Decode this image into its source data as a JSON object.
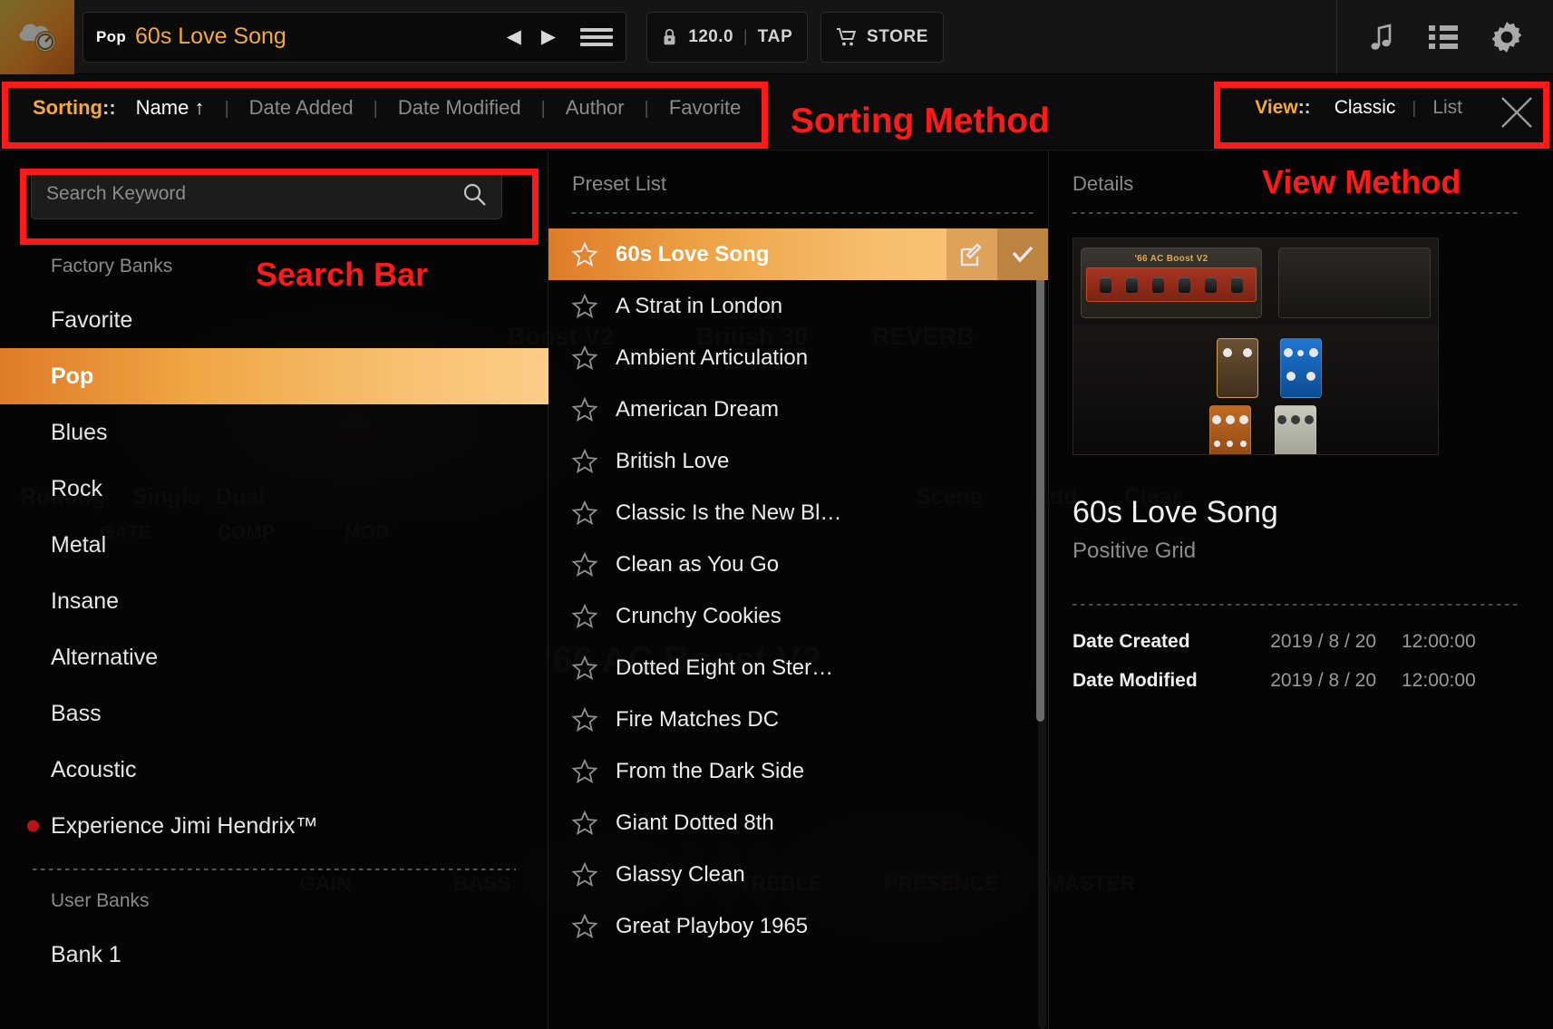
{
  "topbar": {
    "logo_icon": "cloud-gauge-logo",
    "preset_bank": "Pop",
    "preset_name": "60s Love Song",
    "prev_icon": "prev-arrow-icon",
    "next_icon": "next-arrow-icon",
    "menu_icon": "hamburger-menu-icon",
    "lock_icon": "lock-icon",
    "tempo_value": "120.0",
    "tempo_divider": "|",
    "tap_label": "TAP",
    "cart_icon": "shopping-cart-icon",
    "store_label": "STORE",
    "tone_icon": "music-note-icon",
    "list_icon": "list-view-icon",
    "settings_icon": "gear-icon"
  },
  "sortbar": {
    "label": "Sorting",
    "colons": "::",
    "items": [
      {
        "label": "Name ↑",
        "active": true
      },
      {
        "label": "Date Added",
        "active": false
      },
      {
        "label": "Date Modified",
        "active": false
      },
      {
        "label": "Author",
        "active": false
      },
      {
        "label": "Favorite",
        "active": false
      }
    ],
    "separator": "|"
  },
  "viewbar": {
    "label": "View",
    "colons": "::",
    "items": [
      {
        "label": "Classic",
        "active": true
      },
      {
        "label": "List",
        "active": false
      }
    ],
    "separator": "|",
    "close_icon": "close-x-icon"
  },
  "annotations": [
    {
      "text": "Sorting Method"
    },
    {
      "text": "View Method"
    },
    {
      "text": "Search Bar"
    }
  ],
  "search": {
    "placeholder": "Search Keyword",
    "value": "",
    "icon": "search-icon"
  },
  "banks": {
    "factory_header": "Factory Banks",
    "user_header": "User Banks",
    "factory_items": [
      {
        "label": "Favorite",
        "selected": false,
        "dot": false
      },
      {
        "label": "Pop",
        "selected": true,
        "dot": false
      },
      {
        "label": "Blues",
        "selected": false,
        "dot": false
      },
      {
        "label": "Rock",
        "selected": false,
        "dot": false
      },
      {
        "label": "Metal",
        "selected": false,
        "dot": false
      },
      {
        "label": "Insane",
        "selected": false,
        "dot": false
      },
      {
        "label": "Alternative",
        "selected": false,
        "dot": false
      },
      {
        "label": "Bass",
        "selected": false,
        "dot": false
      },
      {
        "label": "Acoustic",
        "selected": false,
        "dot": false
      },
      {
        "label": "Experience Jimi Hendrix™",
        "selected": false,
        "dot": true
      }
    ],
    "user_items": [
      {
        "label": "Bank 1",
        "selected": false,
        "dot": false
      }
    ]
  },
  "presets": {
    "title": "Preset List",
    "star_icon": "star-outline-icon",
    "edit_icon": "edit-pencil-icon",
    "check_icon": "check-mark-icon",
    "items": [
      {
        "label": "60s Love Song",
        "selected": true
      },
      {
        "label": "A Strat in London",
        "selected": false
      },
      {
        "label": "Ambient Articulation",
        "selected": false
      },
      {
        "label": "American Dream",
        "selected": false
      },
      {
        "label": "British Love",
        "selected": false
      },
      {
        "label": "Classic Is the New Bl…",
        "selected": false
      },
      {
        "label": "Clean as You Go",
        "selected": false
      },
      {
        "label": "Crunchy Cookies",
        "selected": false
      },
      {
        "label": "Dotted Eight on Ster…",
        "selected": false
      },
      {
        "label": "Fire Matches DC",
        "selected": false
      },
      {
        "label": "From the Dark Side",
        "selected": false
      },
      {
        "label": "Giant Dotted 8th",
        "selected": false
      },
      {
        "label": "Glassy Clean",
        "selected": false
      },
      {
        "label": "Great Playboy 1965",
        "selected": false
      }
    ]
  },
  "details": {
    "title": "Details",
    "amp_name": "'66 AC Boost V2",
    "preset_title": "60s Love Song",
    "author": "Positive Grid",
    "rows": [
      {
        "key": "Date Created",
        "date": "2019 / 8 / 20",
        "time": "12:00:00"
      },
      {
        "key": "Date Modified",
        "date": "2019 / 8 / 20",
        "time": "12:00:00"
      }
    ]
  },
  "ghost_background": {
    "labels": [
      "Boost V2",
      "British 30",
      "REVERB",
      "Routing",
      "Single",
      "Dual",
      "Scene",
      "Add",
      "Clear",
      "GAIN",
      "BASS",
      "TREBLE",
      "PRESENCE",
      "MASTER",
      "'66 AC Boost V2",
      "GATE",
      "COMP",
      "MOD"
    ]
  },
  "colors": {
    "accent_orange": "#f5a93c",
    "annotation_red": "#ff1a1a",
    "selection_gradient_start": "#df7b28",
    "selection_gradient_end": "#fbcd88",
    "panel_bg": "#050505"
  }
}
